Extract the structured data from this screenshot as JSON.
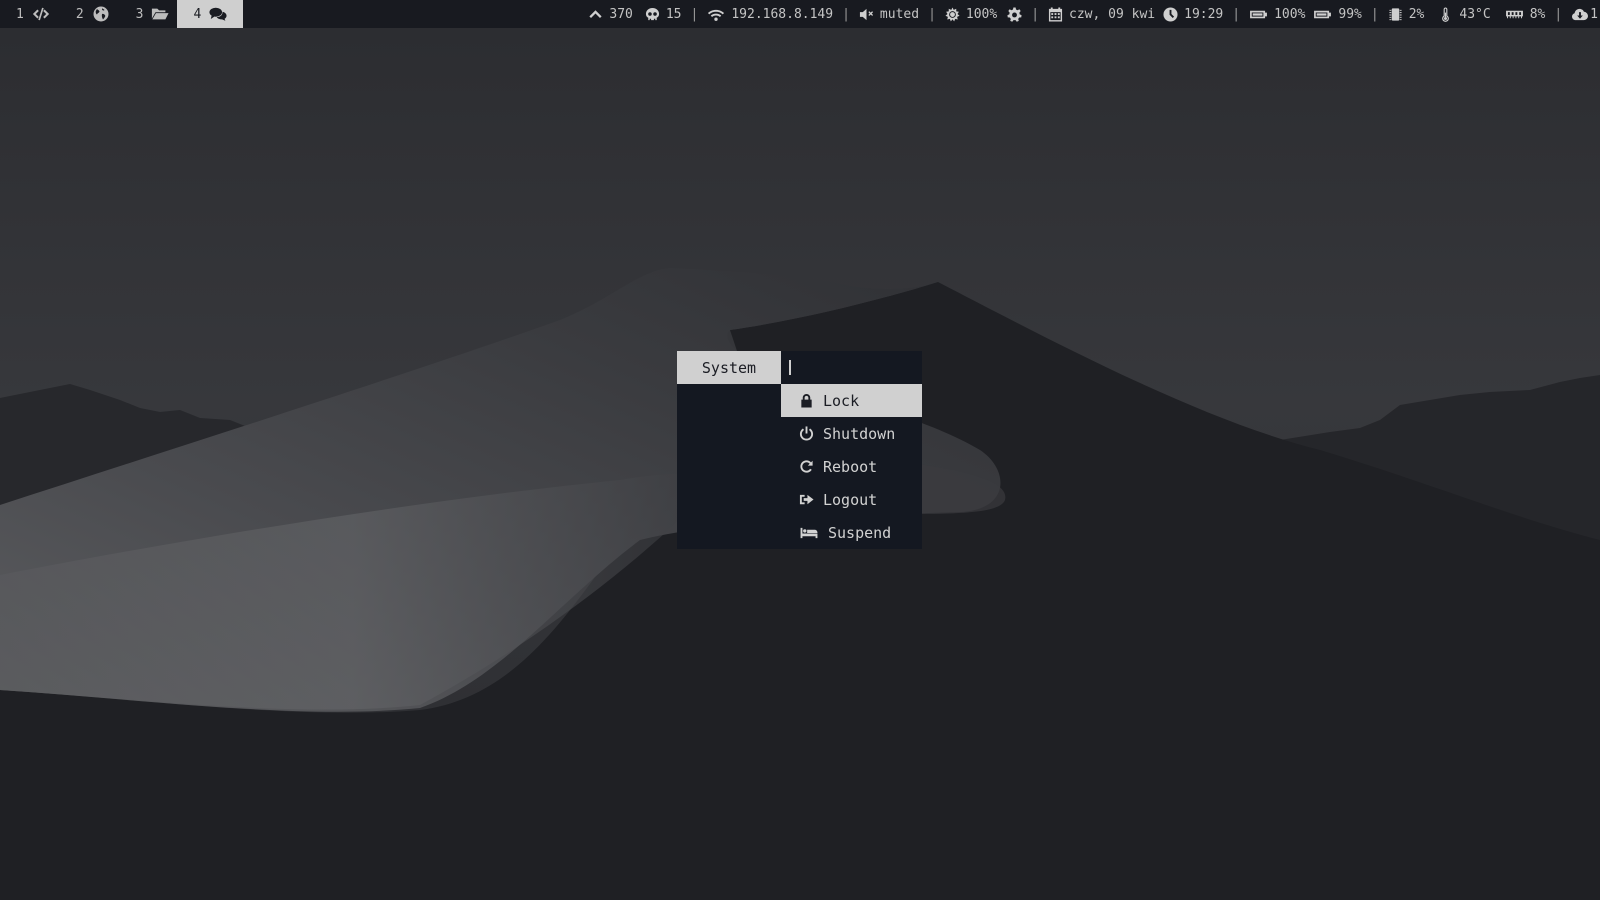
{
  "colors": {
    "bar_bg": "#181a20",
    "active_workspace_bg": "#cfcfcf",
    "launcher_bg": "#141821",
    "selected_bg": "#d0d0d0",
    "text": "#c8c8c8"
  },
  "workspaces": [
    {
      "number": "1",
      "icon": "code-icon",
      "active": false
    },
    {
      "number": "2",
      "icon": "globe-icon",
      "active": false
    },
    {
      "number": "3",
      "icon": "folder-open-icon",
      "active": false
    },
    {
      "number": "4",
      "icon": "comments-icon",
      "active": true
    }
  ],
  "status": {
    "updates": {
      "icon": "chevron-up-icon",
      "value": "370"
    },
    "skull": {
      "icon": "skull-icon",
      "value": "15"
    },
    "network": {
      "icon": "wifi-icon",
      "value": "192.168.8.149"
    },
    "volume": {
      "icon": "volume-mute-icon",
      "value": "muted"
    },
    "brightness": {
      "icon": "brightness-icon",
      "value": "100%"
    },
    "settings": {
      "icon": "gear-icon"
    },
    "date": {
      "icon": "calendar-icon",
      "value": "czw, 09 kwi"
    },
    "time": {
      "icon": "clock-icon",
      "value": "19:29"
    },
    "battery1": {
      "icon": "battery-icon",
      "value": "100%"
    },
    "battery2": {
      "icon": "battery-icon",
      "value": "99%"
    },
    "cpu": {
      "icon": "cpu-icon",
      "value": "2%"
    },
    "temperature": {
      "icon": "thermometer-icon",
      "value": "43°C"
    },
    "memory": {
      "icon": "memory-icon",
      "value": "8%"
    },
    "cloud": {
      "icon": "cloud-download-icon",
      "value": "1"
    },
    "separator": "|"
  },
  "launcher": {
    "prompt": "System",
    "input_value": "",
    "items": [
      {
        "label": "Lock",
        "icon": "lock-icon",
        "selected": true
      },
      {
        "label": "Shutdown",
        "icon": "power-icon",
        "selected": false
      },
      {
        "label": "Reboot",
        "icon": "redo-icon",
        "selected": false
      },
      {
        "label": "Logout",
        "icon": "sign-out-icon",
        "selected": false
      },
      {
        "label": "Suspend",
        "icon": "bed-icon",
        "selected": false
      }
    ]
  }
}
